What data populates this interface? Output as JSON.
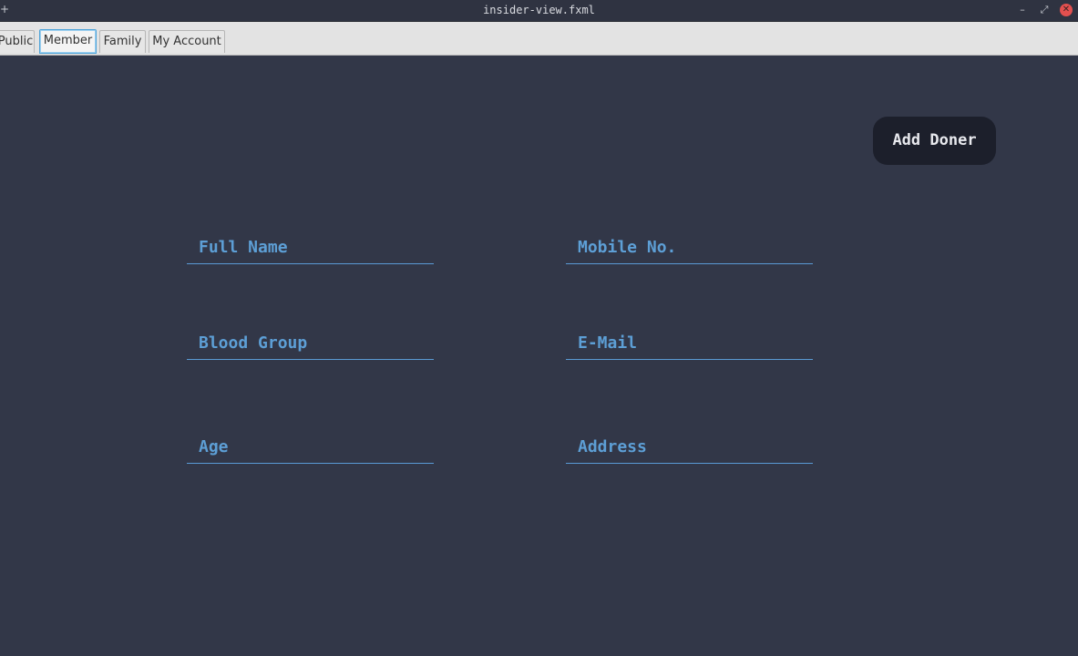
{
  "window": {
    "title": "insider-view.fxml",
    "pin_glyph": "+",
    "minimize_glyph": "–",
    "maximize_glyph": "⤢",
    "close_glyph": "✕"
  },
  "tabs": [
    {
      "label": "Public"
    },
    {
      "label": "Member",
      "active": true
    },
    {
      "label": "Family"
    },
    {
      "label": "My Account"
    }
  ],
  "actions": {
    "add_doner_label": "Add Doner"
  },
  "form": {
    "full_name_placeholder": "Full Name",
    "mobile_placeholder": "Mobile No.",
    "blood_group_placeholder": "Blood Group",
    "email_placeholder": "E-Mail",
    "age_placeholder": "Age",
    "address_placeholder": "Address"
  },
  "colors": {
    "background": "#323748",
    "accent": "#5d9fd6",
    "button": "#1c1f2b"
  }
}
